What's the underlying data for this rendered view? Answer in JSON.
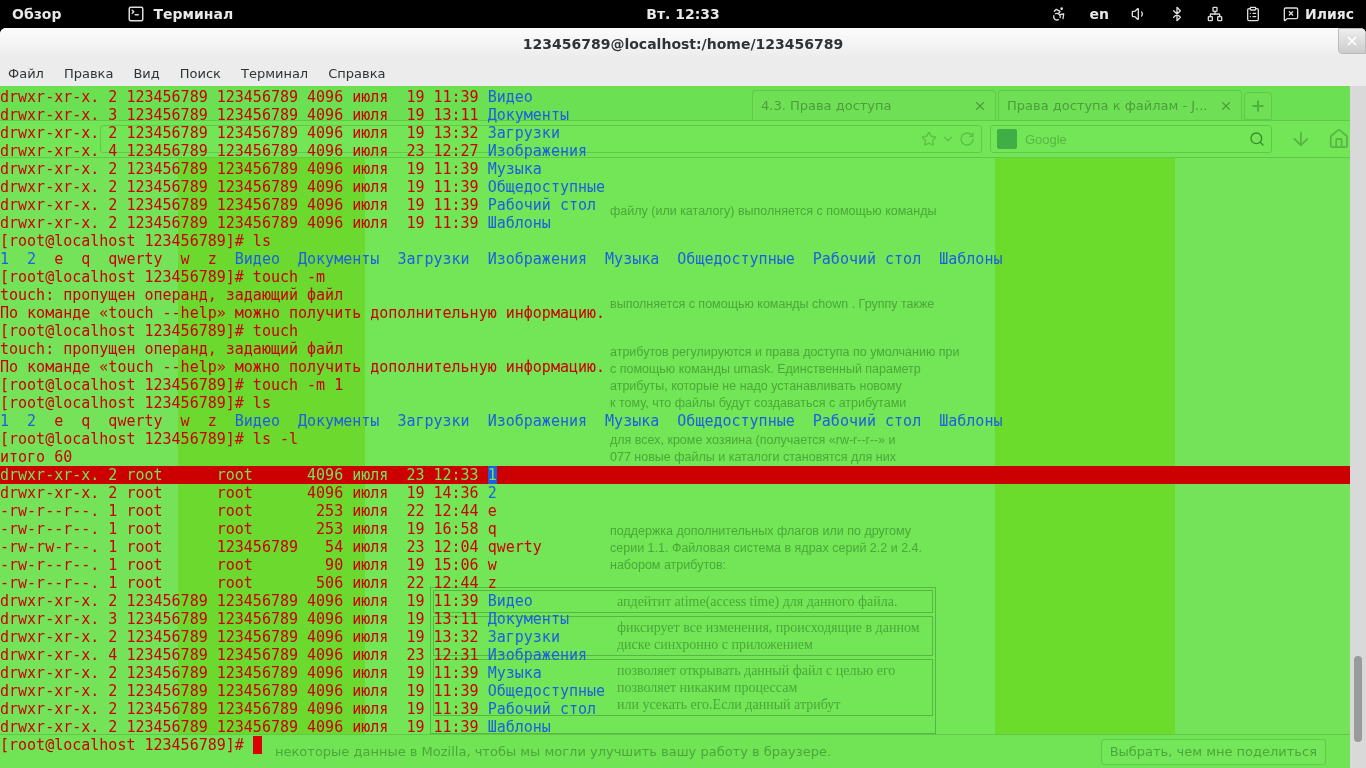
{
  "top_bar": {
    "activities": "Обзор",
    "app": "Терминал",
    "clock": "Вт. 12:33",
    "language": "en",
    "user": "Илияс"
  },
  "window": {
    "title": "123456789@localhost:/home/123456789"
  },
  "menu": [
    "Файл",
    "Правка",
    "Вид",
    "Поиск",
    "Терминал",
    "Справка"
  ],
  "browser": {
    "tabs": [
      {
        "label": "4.3. Права доступа",
        "selected": false
      },
      {
        "label": "Права доступа к файлам - J...",
        "selected": false
      }
    ],
    "search": {
      "placeholder": "Google"
    },
    "paragraphs": [
      [
        "файлу (или каталогу) выполняется с помощью команды"
      ],
      [
        "выполняется с помощью команды chown . Группу также"
      ],
      [
        "атрибутов регулируются и права доступа по умолчанию при",
        "с помощью команды umask. Единственный параметр",
        "атрибуты, которые не надо устанавливать новому",
        "к тому, что файлы будут создаваться с атрибутами"
      ],
      [
        "для всех, кроме хозяина (получается «rw-r--r--» и",
        "077 новые файлы и каталоги становятся для них"
      ],
      [
        "поддержка дополнительных флагов или по другому",
        "серии 1.1. Файловая система в ядрах серий 2.2 и 2.4.",
        "набором атрибутов:"
      ]
    ],
    "table_rows": [
      [
        "апдейтит atime(access time) для данного файла."
      ],
      [
        "фиксирует все изменения, происходящие в данном",
        "диске синхронно с приложением"
      ],
      [
        "позволяет открывать данный файл с целью его",
        "позволяет никаким процессам",
        "или усекать его.Если данный атрибут"
      ]
    ],
    "notification": {
      "text": "некоторые данные в Mozilla, чтобы мы могли улучшить вашу работу в браузере.",
      "button": "Выбрать, чем мне поделиться"
    }
  },
  "terminal": {
    "cursor": true,
    "rows": [
      {
        "selected": false,
        "segments": [
          {
            "kind": "text",
            "text": "drwxr-xr-x. 2 123456789 123456789 4096 июля  19 11:39 "
          },
          {
            "kind": "dir",
            "text": "Видео"
          }
        ]
      },
      {
        "selected": false,
        "segments": [
          {
            "kind": "text",
            "text": "drwxr-xr-x. 3 123456789 123456789 4096 июля  19 13:11 "
          },
          {
            "kind": "dir",
            "text": "Документы"
          }
        ]
      },
      {
        "selected": false,
        "segments": [
          {
            "kind": "text",
            "text": "drwxr-xr-x. 2 123456789 123456789 4096 июля  19 13:32 "
          },
          {
            "kind": "dir",
            "text": "Загрузки"
          }
        ]
      },
      {
        "selected": false,
        "segments": [
          {
            "kind": "text",
            "text": "drwxr-xr-x. 4 123456789 123456789 4096 июля  23 12:27 "
          },
          {
            "kind": "dir",
            "text": "Изображения"
          }
        ]
      },
      {
        "selected": false,
        "segments": [
          {
            "kind": "text",
            "text": "drwxr-xr-x. 2 123456789 123456789 4096 июля  19 11:39 "
          },
          {
            "kind": "dir",
            "text": "Музыка"
          }
        ]
      },
      {
        "selected": false,
        "segments": [
          {
            "kind": "text",
            "text": "drwxr-xr-x. 2 123456789 123456789 4096 июля  19 11:39 "
          },
          {
            "kind": "dir",
            "text": "Общедоступные"
          }
        ]
      },
      {
        "selected": false,
        "segments": [
          {
            "kind": "text",
            "text": "drwxr-xr-x. 2 123456789 123456789 4096 июля  19 11:39 "
          },
          {
            "kind": "dir",
            "text": "Рабочий стол"
          }
        ]
      },
      {
        "selected": false,
        "segments": [
          {
            "kind": "text",
            "text": "drwxr-xr-x. 2 123456789 123456789 4096 июля  19 11:39 "
          },
          {
            "kind": "dir",
            "text": "Шаблоны"
          }
        ]
      },
      {
        "selected": false,
        "segments": [
          {
            "kind": "text",
            "text": "[root@localhost 123456789]# ls"
          }
        ]
      },
      {
        "selected": false,
        "segments": [
          {
            "kind": "dir",
            "text": "1  "
          },
          {
            "kind": "dir",
            "text": "2  "
          },
          {
            "kind": "text",
            "text": "e  q  qwerty  w  z  "
          },
          {
            "kind": "dir",
            "text": "Видео  "
          },
          {
            "kind": "dir",
            "text": "Документы  "
          },
          {
            "kind": "dir",
            "text": "Загрузки  "
          },
          {
            "kind": "dir",
            "text": "Изображения  "
          },
          {
            "kind": "dir",
            "text": "Музыка  "
          },
          {
            "kind": "dir",
            "text": "Общедоступные  "
          },
          {
            "kind": "dir",
            "text": "Рабочий стол  "
          },
          {
            "kind": "dir",
            "text": "Шаблоны"
          }
        ]
      },
      {
        "selected": false,
        "segments": [
          {
            "kind": "text",
            "text": "[root@localhost 123456789]# touch -m"
          }
        ]
      },
      {
        "selected": false,
        "segments": [
          {
            "kind": "text",
            "text": "touch: пропущен операнд, задающий файл"
          }
        ]
      },
      {
        "selected": false,
        "segments": [
          {
            "kind": "text",
            "text": "По команде «touch --help» можно получить дополнительную информацию."
          }
        ]
      },
      {
        "selected": false,
        "segments": [
          {
            "kind": "text",
            "text": "[root@localhost 123456789]# touch"
          }
        ]
      },
      {
        "selected": false,
        "segments": [
          {
            "kind": "text",
            "text": "touch: пропущен операнд, задающий файл"
          }
        ]
      },
      {
        "selected": false,
        "segments": [
          {
            "kind": "text",
            "text": "По команде «touch --help» можно получить дополнительную информацию."
          }
        ]
      },
      {
        "selected": false,
        "segments": [
          {
            "kind": "text",
            "text": "[root@localhost 123456789]# touch -m 1"
          }
        ]
      },
      {
        "selected": false,
        "segments": [
          {
            "kind": "text",
            "text": "[root@localhost 123456789]# ls"
          }
        ]
      },
      {
        "selected": false,
        "segments": [
          {
            "kind": "dir",
            "text": "1  "
          },
          {
            "kind": "dir",
            "text": "2  "
          },
          {
            "kind": "text",
            "text": "e  q  qwerty  w  z  "
          },
          {
            "kind": "dir",
            "text": "Видео  "
          },
          {
            "kind": "dir",
            "text": "Документы  "
          },
          {
            "kind": "dir",
            "text": "Загрузки  "
          },
          {
            "kind": "dir",
            "text": "Изображения  "
          },
          {
            "kind": "dir",
            "text": "Музыка  "
          },
          {
            "kind": "dir",
            "text": "Общедоступные  "
          },
          {
            "kind": "dir",
            "text": "Рабочий стол  "
          },
          {
            "kind": "dir",
            "text": "Шаблоны"
          }
        ]
      },
      {
        "selected": false,
        "segments": [
          {
            "kind": "text",
            "text": "[root@localhost 123456789]# ls -l"
          }
        ]
      },
      {
        "selected": false,
        "segments": [
          {
            "kind": "text",
            "text": "итого 60"
          }
        ]
      },
      {
        "selected": true,
        "segments": [
          {
            "kind": "text",
            "text": "drwxr-xr-x. 2 root      root      4096 июля  23 12:33 "
          },
          {
            "kind": "dir",
            "text": "1"
          }
        ]
      },
      {
        "selected": false,
        "segments": [
          {
            "kind": "text",
            "text": "drwxr-xr-x. 2 root      root      4096 июля  19 14:36 "
          },
          {
            "kind": "dir",
            "text": "2"
          }
        ]
      },
      {
        "selected": false,
        "segments": [
          {
            "kind": "text",
            "text": "-rw-r--r--. 1 root      root       253 июля  22 12:44 e"
          }
        ]
      },
      {
        "selected": false,
        "segments": [
          {
            "kind": "text",
            "text": "-rw-r--r--. 1 root      root       253 июля  19 16:58 q"
          }
        ]
      },
      {
        "selected": false,
        "segments": [
          {
            "kind": "text",
            "text": "-rw-rw-r--. 1 root      123456789   54 июля  23 12:04 qwerty"
          }
        ]
      },
      {
        "selected": false,
        "segments": [
          {
            "kind": "text",
            "text": "-rw-r--r--. 1 root      root        90 июля  19 15:06 w"
          }
        ]
      },
      {
        "selected": false,
        "segments": [
          {
            "kind": "text",
            "text": "-rw-r--r--. 1 root      root       506 июля  22 12:44 z"
          }
        ]
      },
      {
        "selected": false,
        "segments": [
          {
            "kind": "text",
            "text": "drwxr-xr-x. 2 123456789 123456789 4096 июля  19 11:39 "
          },
          {
            "kind": "dir",
            "text": "Видео"
          }
        ]
      },
      {
        "selected": false,
        "segments": [
          {
            "kind": "text",
            "text": "drwxr-xr-x. 3 123456789 123456789 4096 июля  19 13:11 "
          },
          {
            "kind": "dir",
            "text": "Документы"
          }
        ]
      },
      {
        "selected": false,
        "segments": [
          {
            "kind": "text",
            "text": "drwxr-xr-x. 2 123456789 123456789 4096 июля  19 13:32 "
          },
          {
            "kind": "dir",
            "text": "Загрузки"
          }
        ]
      },
      {
        "selected": false,
        "segments": [
          {
            "kind": "text",
            "text": "drwxr-xr-x. 4 123456789 123456789 4096 июля  23 12:31 "
          },
          {
            "kind": "dir",
            "text": "Изображения"
          }
        ]
      },
      {
        "selected": false,
        "segments": [
          {
            "kind": "text",
            "text": "drwxr-xr-x. 2 123456789 123456789 4096 июля  19 11:39 "
          },
          {
            "kind": "dir",
            "text": "Музыка"
          }
        ]
      },
      {
        "selected": false,
        "segments": [
          {
            "kind": "text",
            "text": "drwxr-xr-x. 2 123456789 123456789 4096 июля  19 11:39 "
          },
          {
            "kind": "dir",
            "text": "Общедоступные"
          }
        ]
      },
      {
        "selected": false,
        "segments": [
          {
            "kind": "text",
            "text": "drwxr-xr-x. 2 123456789 123456789 4096 июля  19 11:39 "
          },
          {
            "kind": "dir",
            "text": "Рабочий стол"
          }
        ]
      },
      {
        "selected": false,
        "segments": [
          {
            "kind": "text",
            "text": "drwxr-xr-x. 2 123456789 123456789 4096 июля  19 11:39 "
          },
          {
            "kind": "dir",
            "text": "Шаблоны"
          }
        ]
      },
      {
        "selected": false,
        "segments": [
          {
            "kind": "text",
            "text": "[root@localhost 123456789]# "
          }
        ]
      }
    ]
  }
}
